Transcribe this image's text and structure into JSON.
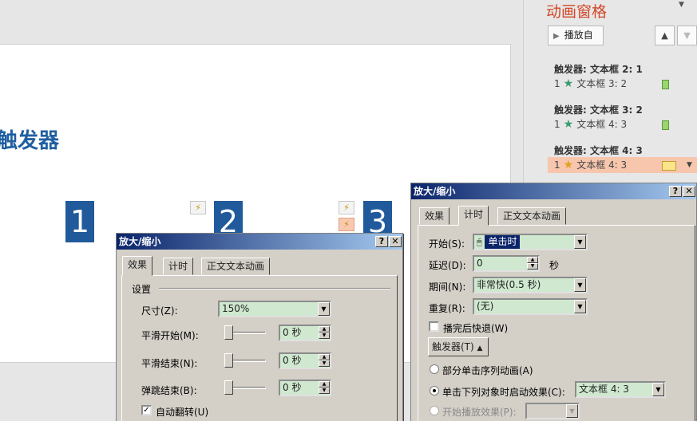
{
  "slide": {
    "title": "触发器",
    "boxes": [
      "1",
      "2",
      "3"
    ],
    "trigger_glyph": "⚡"
  },
  "pane": {
    "title": "动画窗格",
    "play_label": "播放自",
    "up": "▲",
    "down": "▼",
    "groups": [
      {
        "header": "触发器: 文本框 2: 1",
        "item": {
          "order": "1",
          "text": "文本框 3: 2"
        }
      },
      {
        "header": "触发器: 文本框 3: 2",
        "item": {
          "order": "1",
          "text": "文本框 4: 3"
        }
      },
      {
        "header": "触发器: 文本框 4: 3",
        "item": {
          "order": "1",
          "text": "文本框 4: 3"
        }
      }
    ]
  },
  "dialog_left": {
    "title": "放大/缩小",
    "help": "?",
    "close": "✕",
    "tabs": [
      "效果",
      "计时",
      "正文文本动画"
    ],
    "section": "设置",
    "size_label": "尺寸(Z):",
    "size_value": "150%",
    "smooth_start_label": "平滑开始(M):",
    "smooth_start_value": "0 秒",
    "smooth_end_label": "平滑结束(N):",
    "smooth_end_value": "0 秒",
    "bounce_end_label": "弹跳结束(B):",
    "bounce_end_value": "0 秒",
    "auto_reverse_label": "自动翻转(U)"
  },
  "dialog_right": {
    "title": "放大/缩小",
    "help": "?",
    "close": "✕",
    "tabs": [
      "效果",
      "计时",
      "正文文本动画"
    ],
    "start_label": "开始(S):",
    "start_value": "单击时",
    "delay_label": "延迟(D):",
    "delay_value": "0",
    "delay_unit": "秒",
    "period_label": "期间(N):",
    "period_value": "非常快(0.5 秒)",
    "repeat_label": "重复(R):",
    "repeat_value": "(无)",
    "rewind_label": "播完后快退(W)",
    "trigger_btn": "触发器(T)",
    "radio1_label": "部分单击序列动画(A)",
    "radio2_label": "单击下列对象时启动效果(C):",
    "radio2_value": "文本框 4: 3",
    "radio3_label": "开始播放效果(P):"
  }
}
